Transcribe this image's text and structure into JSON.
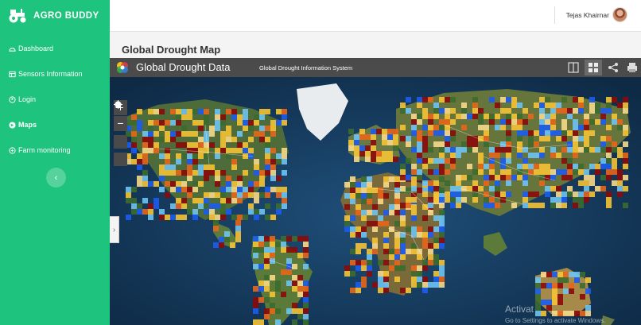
{
  "app": {
    "brand": "AGRO BUDDY"
  },
  "sidebar": {
    "items": [
      {
        "label": "Dashboard",
        "icon": "dashboard-icon",
        "active": false
      },
      {
        "label": "Sensors Information",
        "icon": "table-icon",
        "active": false
      },
      {
        "label": "Login",
        "icon": "login-icon",
        "active": false
      },
      {
        "label": "Maps",
        "icon": "map-icon",
        "active": true
      },
      {
        "label": "Farm monitoring",
        "icon": "farm-icon",
        "active": false
      }
    ],
    "collapse_icon": "‹"
  },
  "header": {
    "user_name": "Tejas Khairnar"
  },
  "page": {
    "title": "Global Drought Map"
  },
  "map": {
    "title": "Global Drought Data",
    "subtitle": "Global Drought Information System",
    "zoom_in": "+",
    "zoom_out": "−",
    "tools": [
      "swipe-icon",
      "grid-icon",
      "share-icon",
      "print-icon"
    ]
  },
  "watermark": {
    "title": "Activat",
    "subtitle": "Go to Settings to activate Windows."
  },
  "colors": {
    "sidebar": "#1ec37d",
    "map_header": "#4b4b4b",
    "ocean": "#12304f",
    "drought_severe": "#8b0a0a",
    "drought_moderate": "#e8661a",
    "drought_mild": "#f5c334",
    "wet": "#1b5cf0",
    "wet_mild": "#6ec3f2"
  }
}
